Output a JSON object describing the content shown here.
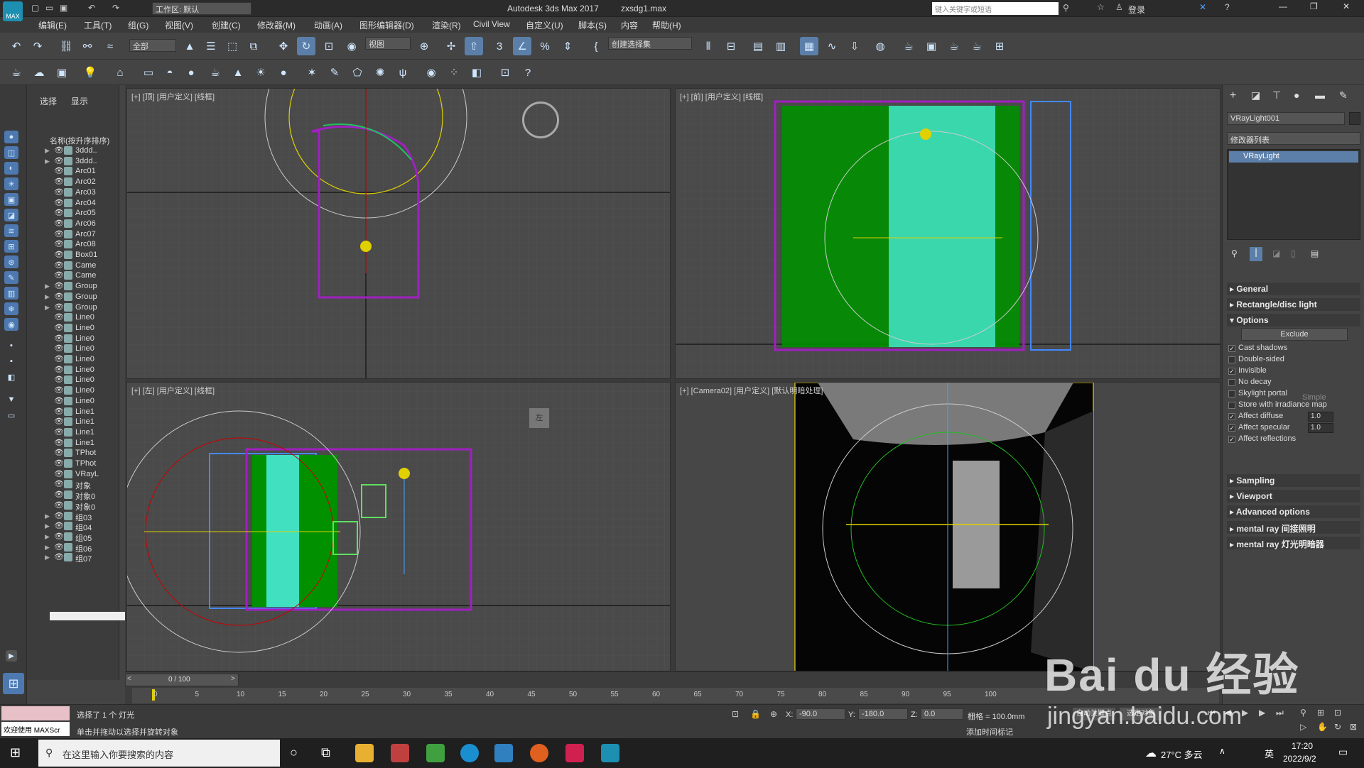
{
  "title_bar": {
    "app_title": "Autodesk 3ds Max 2017",
    "file_name": "zxsdg1.max",
    "workspace": "工作区: 默认",
    "search_placeholder": "键入关键字或短语",
    "login": "登录",
    "logo": "MAX"
  },
  "menus": [
    "编辑(E)",
    "工具(T)",
    "组(G)",
    "视图(V)",
    "创建(C)",
    "修改器(M)",
    "动画(A)",
    "图形编辑器(D)",
    "渲染(R)",
    "Civil View",
    "自定义(U)",
    "脚本(S)",
    "内容",
    "帮助(H)"
  ],
  "toolbar": {
    "filter": "全部",
    "ref_coord": "视图",
    "selection_set": "创建选择集"
  },
  "scene_explorer": {
    "tabs": [
      "选择",
      "显示"
    ],
    "header": "名称(按升序排序)",
    "items": [
      {
        "label": "3ddd..",
        "expand": true
      },
      {
        "label": "3ddd..",
        "expand": true
      },
      {
        "label": "Arc01",
        "expand": false
      },
      {
        "label": "Arc02",
        "expand": false
      },
      {
        "label": "Arc03",
        "expand": false
      },
      {
        "label": "Arc04",
        "expand": false
      },
      {
        "label": "Arc05",
        "expand": false
      },
      {
        "label": "Arc06",
        "expand": false
      },
      {
        "label": "Arc07",
        "expand": false
      },
      {
        "label": "Arc08",
        "expand": false
      },
      {
        "label": "Box01",
        "expand": false
      },
      {
        "label": "Came",
        "expand": false
      },
      {
        "label": "Came",
        "expand": false
      },
      {
        "label": "Group",
        "expand": true
      },
      {
        "label": "Group",
        "expand": true
      },
      {
        "label": "Group",
        "expand": true
      },
      {
        "label": "Line0",
        "expand": false
      },
      {
        "label": "Line0",
        "expand": false
      },
      {
        "label": "Line0",
        "expand": false
      },
      {
        "label": "Line0",
        "expand": false
      },
      {
        "label": "Line0",
        "expand": false
      },
      {
        "label": "Line0",
        "expand": false
      },
      {
        "label": "Line0",
        "expand": false
      },
      {
        "label": "Line0",
        "expand": false
      },
      {
        "label": "Line0",
        "expand": false
      },
      {
        "label": "Line1",
        "expand": false
      },
      {
        "label": "Line1",
        "expand": false
      },
      {
        "label": "Line1",
        "expand": false
      },
      {
        "label": "Line1",
        "expand": false
      },
      {
        "label": "TPhot",
        "expand": false
      },
      {
        "label": "TPhot",
        "expand": false
      },
      {
        "label": "VRayL",
        "expand": false
      },
      {
        "label": "对象",
        "expand": false
      },
      {
        "label": "对象0",
        "expand": false
      },
      {
        "label": "对象0",
        "expand": false
      },
      {
        "label": "组03",
        "expand": true
      },
      {
        "label": "组04",
        "expand": true
      },
      {
        "label": "组05",
        "expand": true
      },
      {
        "label": "组06",
        "expand": true
      },
      {
        "label": "组07",
        "expand": true
      }
    ]
  },
  "viewports": {
    "top": "[+] [顶] [用户定义] [线框]",
    "front": "[+] [前] [用户定义] [线框]",
    "left": "[+] [左] [用户定义] [线框]",
    "camera": "[+] [Camera02] [用户定义] [默认明暗处理]",
    "left_cube": "左"
  },
  "command_panel": {
    "object_name": "VRayLight001",
    "modifier_list": "修改器列表",
    "stack_item": "VRayLight",
    "rollouts": [
      "General",
      "Rectangle/disc light",
      "Options",
      "Sampling",
      "Viewport",
      "Advanced options",
      "mental ray 间接照明",
      "mental ray 灯光明暗器"
    ],
    "exclude_button": "Exclude",
    "options": [
      {
        "label": "Cast shadows",
        "checked": true
      },
      {
        "label": "Double-sided",
        "checked": false
      },
      {
        "label": "Invisible",
        "checked": true
      },
      {
        "label": "No decay",
        "checked": false
      },
      {
        "label": "Skylight portal",
        "checked": false
      },
      {
        "label": "Store with irradiance map",
        "checked": false
      },
      {
        "label": "Affect diffuse",
        "checked": true,
        "value": "1.0"
      },
      {
        "label": "Affect specular",
        "checked": true,
        "value": "1.0"
      },
      {
        "label": "Affect reflections",
        "checked": true
      }
    ],
    "simple": "Simple"
  },
  "timeline": {
    "frame": "0 / 100",
    "ticks": [
      "0",
      "5",
      "10",
      "15",
      "20",
      "25",
      "30",
      "35",
      "40",
      "45",
      "50",
      "55",
      "60",
      "65",
      "70",
      "75",
      "80",
      "85",
      "90",
      "95",
      "100"
    ]
  },
  "status": {
    "selected": "选择了 1 个 灯光",
    "hint": "单击并拖动以选择并旋转对象",
    "welcome": "欢迎使用 MAXScr",
    "x_label": "X:",
    "x": "-90.0",
    "y_label": "Y:",
    "y": "-180.0",
    "z_label": "Z:",
    "z": "0.0",
    "grid": "栅格 = 100.0mm",
    "add_time_tag": "添加时间标记",
    "auto_key": "自动关键点",
    "selected_objects": "选定对象"
  },
  "taskbar": {
    "search_placeholder": "在这里输入你要搜索的内容",
    "weather": "27°C 多云",
    "ime": "英",
    "time": "17:20",
    "date": "2022/9/2"
  },
  "watermark": {
    "brand": "Bai du 经验",
    "url": "jingyan.baidu.com"
  },
  "colors": {
    "accent": "#5b7fa8",
    "green": "#00a000",
    "cyan": "#40e0c0",
    "magenta": "#a020c0",
    "light_yellow": "#f0d000"
  }
}
